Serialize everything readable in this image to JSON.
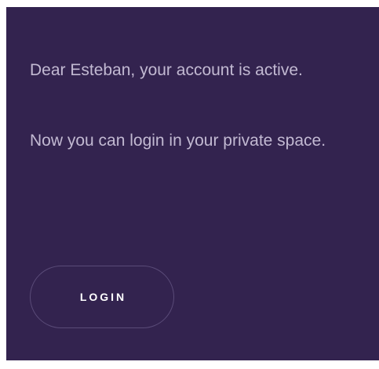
{
  "message": {
    "line1": "Dear Esteban, your account is active.",
    "line2": "Now you can login in your private space."
  },
  "actions": {
    "login_label": "LOGIN"
  },
  "colors": {
    "panel_background": "#33234f",
    "text": "#c2b9d2",
    "button_border": "#5a4b78",
    "button_text": "#ffffff"
  }
}
